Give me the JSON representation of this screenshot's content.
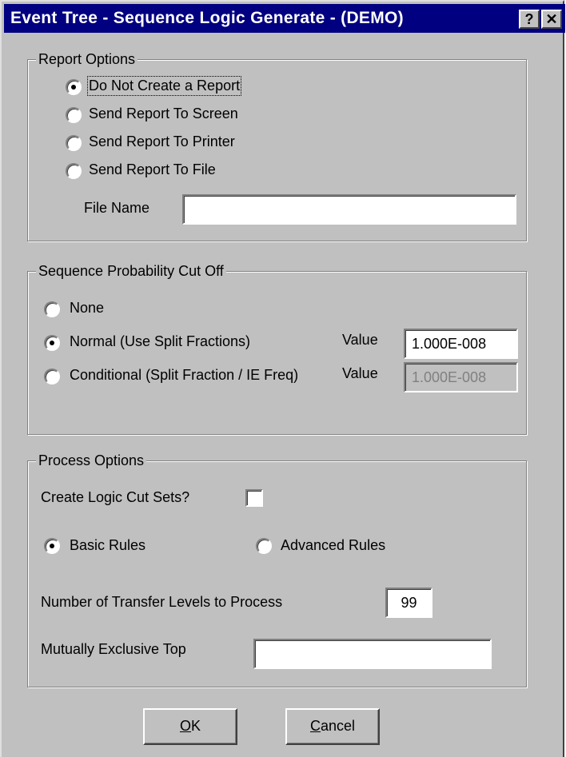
{
  "window": {
    "title": "Event Tree - Sequence Logic Generate  -  (DEMO)",
    "help_glyph": "?",
    "close_glyph": "✕"
  },
  "report_options": {
    "legend": "Report Options",
    "options": [
      {
        "label": "Do Not Create a Report",
        "checked": true
      },
      {
        "label": "Send Report To Screen",
        "checked": false
      },
      {
        "label": "Send Report To Printer",
        "checked": false
      },
      {
        "label": "Send Report To File",
        "checked": false
      }
    ],
    "file_name_label": "File Name",
    "file_name_value": ""
  },
  "cutoff": {
    "legend": "Sequence Probability Cut Off",
    "none_label": "None",
    "normal_label": "Normal (Use Split Fractions)",
    "conditional_label": "Conditional (Split Fraction / IE Freq)",
    "value_label": "Value",
    "normal_value": "1.000E-008",
    "conditional_value": "1.000E-008",
    "selected": "normal"
  },
  "process_options": {
    "legend": "Process Options",
    "create_cut_sets_label": "Create Logic Cut Sets?",
    "create_cut_sets_checked": false,
    "basic_rules_label": "Basic Rules",
    "advanced_rules_label": "Advanced Rules",
    "rules_selected": "basic",
    "transfer_levels_label": "Number of Transfer Levels to Process",
    "transfer_levels_value": "99",
    "mutually_exclusive_label": "Mutually Exclusive Top",
    "mutually_exclusive_value": ""
  },
  "buttons": {
    "ok_mnemonic": "O",
    "ok_rest": "K",
    "cancel_mnemonic": "C",
    "cancel_rest": "ancel"
  }
}
